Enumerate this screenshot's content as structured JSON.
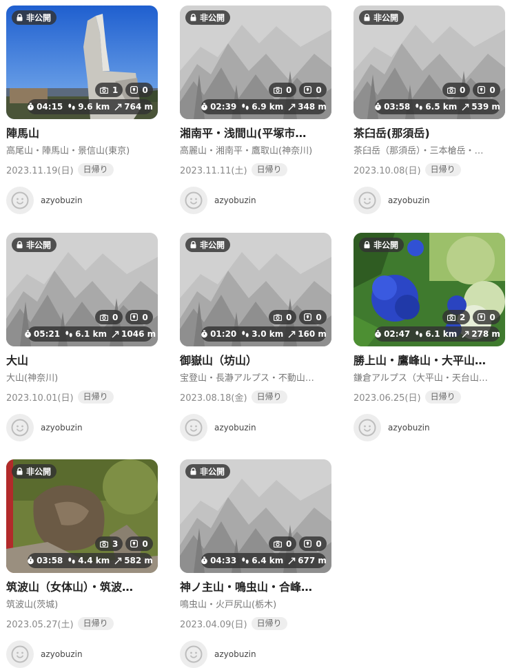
{
  "private_label": "非公開",
  "trip_type_label": "日帰り",
  "username": "azyobuzin",
  "cards": [
    {
      "title": "陣馬山",
      "areas": "高尾山・陣馬山・景信山(東京)",
      "date": "2023.11.19(日)",
      "photos": "1",
      "markers": "0",
      "time": "04:15",
      "distance": "9.6 km",
      "ascent": "764 m",
      "thumb": "photo-jinba"
    },
    {
      "title": "湘南平・浅間山(平塚市…",
      "areas": "高麗山・湘南平・鷹取山(神奈川)",
      "date": "2023.11.11(土)",
      "photos": "0",
      "markers": "0",
      "time": "02:39",
      "distance": "6.9 km",
      "ascent": "348 m",
      "thumb": "placeholder"
    },
    {
      "title": "茶臼岳(那須岳)",
      "areas": "茶臼岳（那須岳）・三本槍岳・…",
      "date": "2023.10.08(日)",
      "photos": "0",
      "markers": "0",
      "time": "03:58",
      "distance": "6.5 km",
      "ascent": "539 m",
      "thumb": "placeholder"
    },
    {
      "title": "大山",
      "areas": "大山(神奈川)",
      "date": "2023.10.01(日)",
      "photos": "0",
      "markers": "0",
      "time": "05:21",
      "distance": "6.1 km",
      "ascent": "1046 m",
      "thumb": "placeholder"
    },
    {
      "title": "御嶽山（坊山）",
      "areas": "宝登山・長瀞アルプス・不動山…",
      "date": "2023.08.18(金)",
      "photos": "0",
      "markers": "0",
      "time": "01:20",
      "distance": "3.0 km",
      "ascent": "160 m",
      "thumb": "placeholder"
    },
    {
      "title": "勝上山・鷹峰山・大平山…",
      "areas": "鎌倉アルプス（大平山・天台山…",
      "date": "2023.06.25(日)",
      "photos": "2",
      "markers": "0",
      "time": "02:47",
      "distance": "6.1 km",
      "ascent": "278 m",
      "thumb": "photo-hydrangea"
    },
    {
      "title": "筑波山（女体山）・筑波…",
      "areas": "筑波山(茨城)",
      "date": "2023.05.27(土)",
      "photos": "3",
      "markers": "0",
      "time": "03:58",
      "distance": "4.4 km",
      "ascent": "582 m",
      "thumb": "photo-frog"
    },
    {
      "title": "神ノ主山・鳴虫山・合峰…",
      "areas": "鳴虫山・火戸尻山(栃木)",
      "date": "2023.04.09(日)",
      "photos": "0",
      "markers": "0",
      "time": "04:33",
      "distance": "6.4 km",
      "ascent": "677 m",
      "thumb": "placeholder"
    }
  ]
}
